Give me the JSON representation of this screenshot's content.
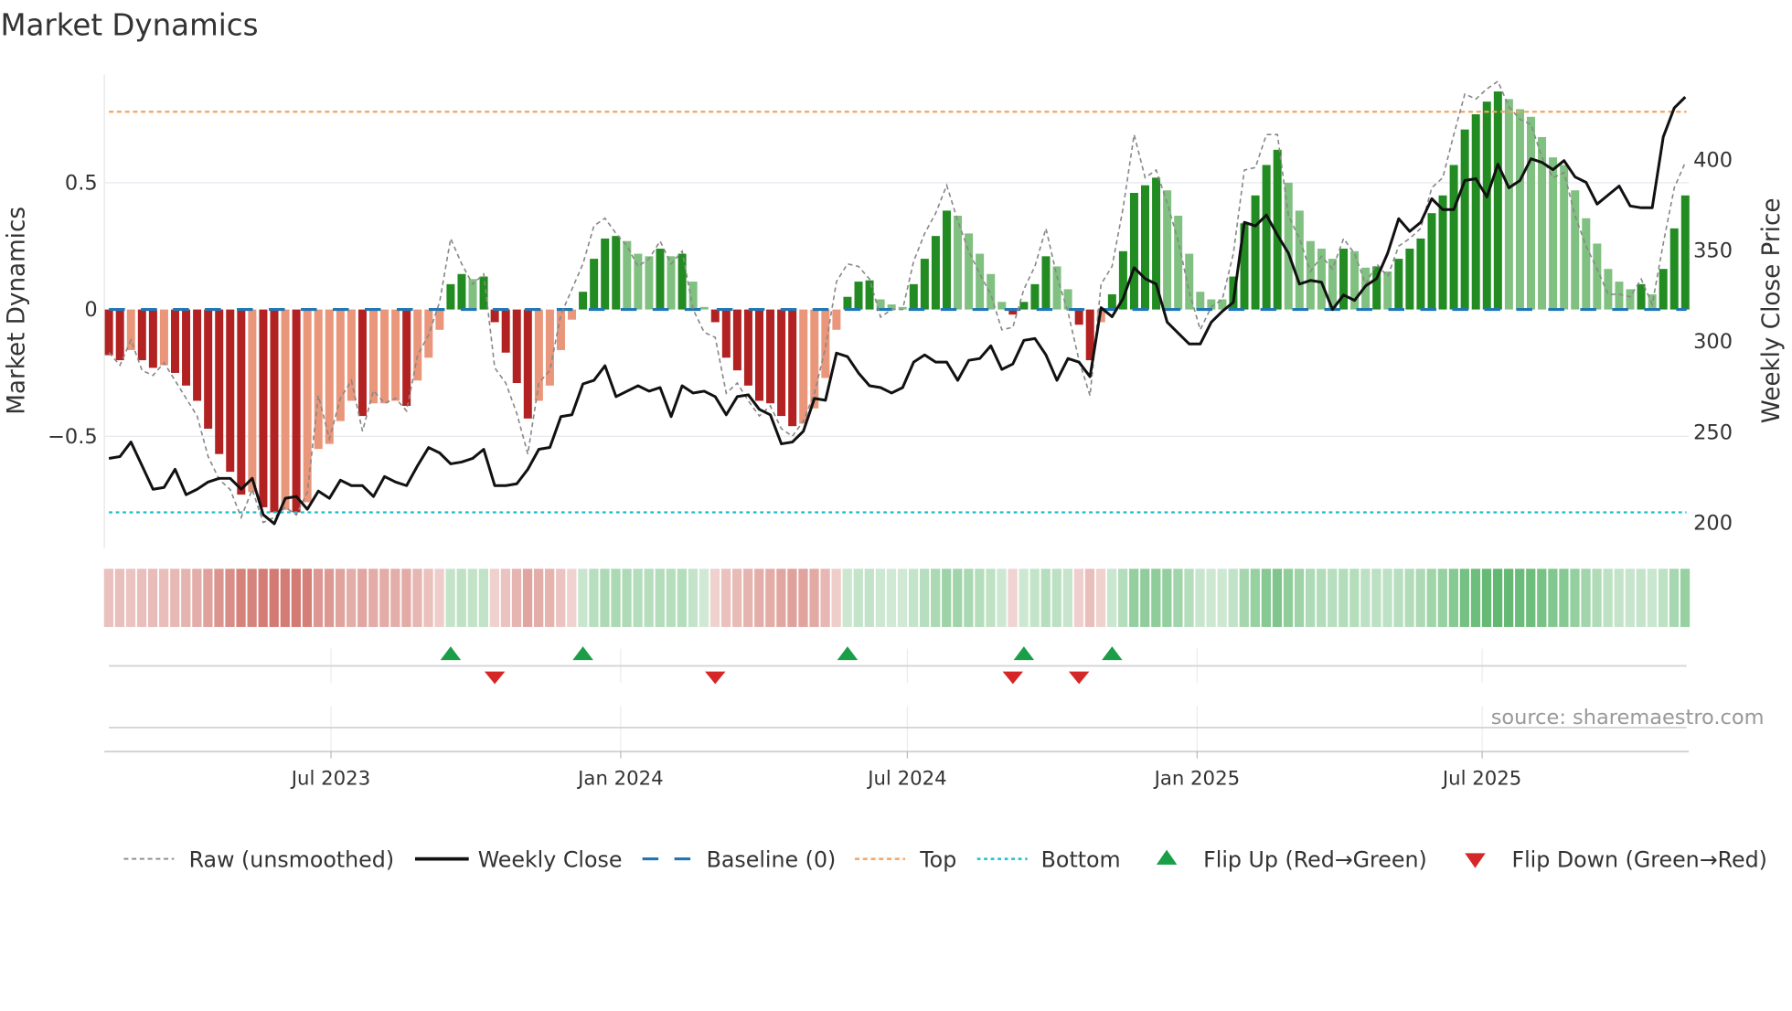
{
  "chart_data": {
    "type": "bar",
    "title": "Market Dynamics",
    "ylabel": "Market Dynamics",
    "y2label": "Weekly Close Price",
    "ylim": [
      -0.95,
      0.93
    ],
    "y2lim": [
      186,
      451
    ],
    "yticks": [
      {
        "v": 0.5,
        "label": "0.5"
      },
      {
        "v": 0,
        "label": "0"
      },
      {
        "v": -0.5,
        "label": "−0.5"
      }
    ],
    "y2ticks": [
      {
        "v": 400,
        "label": "400"
      },
      {
        "v": 350,
        "label": "350"
      },
      {
        "v": 300,
        "label": "300"
      },
      {
        "v": 250,
        "label": "250"
      },
      {
        "v": 200,
        "label": "200"
      }
    ],
    "x_start": "2023-02-10",
    "x_interval_days": 7,
    "xticks": [
      {
        "date": "2023-07-01",
        "label": "Jul 2023"
      },
      {
        "date": "2024-01-01",
        "label": "Jan 2024"
      },
      {
        "date": "2024-07-01",
        "label": "Jul 2024"
      },
      {
        "date": "2025-01-01",
        "label": "Jan 2025"
      },
      {
        "date": "2025-07-01",
        "label": "Jul 2025"
      }
    ],
    "top_level": 0.78,
    "bottom_level": -0.8,
    "baseline": 0,
    "dynamics": [
      -0.18,
      -0.2,
      -0.16,
      -0.2,
      -0.23,
      -0.22,
      -0.25,
      -0.3,
      -0.36,
      -0.47,
      -0.57,
      -0.64,
      -0.73,
      -0.72,
      -0.78,
      -0.8,
      -0.79,
      -0.8,
      -0.76,
      -0.55,
      -0.53,
      -0.44,
      -0.36,
      -0.42,
      -0.37,
      -0.37,
      -0.36,
      -0.38,
      -0.28,
      -0.19,
      -0.08,
      0.1,
      0.14,
      0.12,
      0.13,
      -0.05,
      -0.17,
      -0.29,
      -0.43,
      -0.36,
      -0.3,
      -0.16,
      -0.04,
      0.07,
      0.2,
      0.28,
      0.29,
      0.27,
      0.22,
      0.21,
      0.24,
      0.21,
      0.22,
      0.11,
      0.01,
      -0.05,
      -0.19,
      -0.24,
      -0.3,
      -0.36,
      -0.37,
      -0.42,
      -0.46,
      -0.45,
      -0.39,
      -0.27,
      -0.08,
      0.05,
      0.11,
      0.115,
      0.04,
      0.02,
      0.01,
      0.1,
      0.2,
      0.29,
      0.39,
      0.37,
      0.3,
      0.22,
      0.14,
      0.03,
      -0.02,
      0.03,
      0.1,
      0.21,
      0.17,
      0.08,
      -0.06,
      -0.2,
      -0.05,
      0.06,
      0.23,
      0.46,
      0.49,
      0.52,
      0.47,
      0.37,
      0.22,
      0.07,
      0.04,
      0.04,
      0.13,
      0.34,
      0.45,
      0.57,
      0.63,
      0.5,
      0.39,
      0.27,
      0.24,
      0.2,
      0.24,
      0.23,
      0.165,
      0.17,
      0.15,
      0.2,
      0.24,
      0.28,
      0.38,
      0.45,
      0.57,
      0.71,
      0.77,
      0.82,
      0.86,
      0.83,
      0.79,
      0.76,
      0.68,
      0.6,
      0.57,
      0.47,
      0.36,
      0.26,
      0.16,
      0.11,
      0.08,
      0.1,
      0.06,
      0.16,
      0.32,
      0.45
    ],
    "raw": [
      -0.17,
      -0.22,
      -0.12,
      -0.24,
      -0.26,
      -0.21,
      -0.28,
      -0.35,
      -0.42,
      -0.58,
      -0.67,
      -0.71,
      -0.82,
      -0.71,
      -0.84,
      -0.82,
      -0.78,
      -0.81,
      -0.72,
      -0.34,
      -0.51,
      -0.35,
      -0.28,
      -0.48,
      -0.32,
      -0.37,
      -0.35,
      -0.4,
      -0.18,
      -0.1,
      0.03,
      0.28,
      0.18,
      0.1,
      0.14,
      -0.23,
      -0.29,
      -0.41,
      -0.57,
      -0.29,
      -0.24,
      -0.02,
      0.08,
      0.18,
      0.33,
      0.36,
      0.3,
      0.25,
      0.17,
      0.2,
      0.27,
      0.18,
      0.23,
      0.0,
      -0.09,
      -0.11,
      -0.33,
      -0.29,
      -0.36,
      -0.42,
      -0.38,
      -0.47,
      -0.5,
      -0.44,
      -0.33,
      -0.15,
      0.11,
      0.18,
      0.17,
      0.12,
      -0.03,
      0.0,
      0.0,
      0.19,
      0.3,
      0.38,
      0.49,
      0.35,
      0.23,
      0.14,
      0.06,
      -0.08,
      -0.07,
      0.08,
      0.17,
      0.32,
      0.13,
      -0.01,
      -0.2,
      -0.34,
      0.1,
      0.17,
      0.4,
      0.69,
      0.52,
      0.55,
      0.42,
      0.27,
      0.07,
      -0.08,
      0.01,
      0.04,
      0.22,
      0.55,
      0.56,
      0.69,
      0.69,
      0.37,
      0.28,
      0.15,
      0.21,
      0.16,
      0.28,
      0.22,
      0.1,
      0.18,
      0.13,
      0.25,
      0.28,
      0.32,
      0.48,
      0.52,
      0.69,
      0.85,
      0.83,
      0.87,
      0.9,
      0.8,
      0.75,
      0.73,
      0.6,
      0.52,
      0.54,
      0.37,
      0.25,
      0.16,
      0.06,
      0.06,
      0.05,
      0.12,
      0.02,
      0.26,
      0.48,
      0.58
    ],
    "close": [
      235,
      236,
      244,
      231,
      218,
      219,
      229,
      215,
      218,
      222,
      224,
      224,
      218,
      224,
      204,
      199,
      213,
      214,
      207,
      217,
      213,
      223,
      220,
      220,
      214,
      225,
      222,
      220,
      231,
      241,
      238,
      232,
      233,
      235,
      240,
      220,
      220,
      221,
      229,
      240,
      241,
      258,
      259,
      276,
      278,
      286,
      269,
      272,
      275,
      272,
      274,
      258,
      275,
      271,
      272,
      269,
      259,
      269,
      270,
      262,
      259,
      243,
      244,
      250,
      268,
      267,
      293,
      291,
      282,
      275,
      274,
      271,
      274,
      288,
      292,
      288,
      288,
      278,
      289,
      290,
      297,
      284,
      287,
      300,
      301,
      292,
      278,
      290,
      288,
      280,
      318,
      313,
      323,
      340,
      334,
      331,
      310,
      304,
      298,
      298,
      310,
      316,
      321,
      365,
      363,
      369,
      358,
      348,
      331,
      333,
      332,
      317,
      325,
      322,
      330,
      334,
      348,
      367,
      360,
      365,
      378,
      372,
      372,
      388,
      389,
      379,
      397,
      384,
      388,
      400,
      398,
      394,
      399,
      390,
      387,
      375,
      380,
      385,
      374,
      373,
      373,
      412,
      428,
      434
    ],
    "flip_up": [
      31,
      43,
      67,
      83,
      91
    ],
    "flip_down": [
      35,
      55,
      82,
      88
    ],
    "legend_placement": "bottom",
    "legend": {
      "raw": "Raw (unsmoothed)",
      "close": "Weekly Close",
      "baseline": "Baseline (0)",
      "top": "Top",
      "bottom": "Bottom",
      "flip_up": "Flip Up (Red→Green)",
      "flip_down": "Flip Down (Green→Red)"
    },
    "source": "source: sharemaestro.com",
    "colors": {
      "bar_neg_strong": "#b22222",
      "bar_neg_weak": "#e9967a",
      "bar_pos_strong": "#228b22",
      "bar_pos_weak": "#80c080",
      "close": "#111111",
      "raw": "#888888",
      "baseline": "#1f77b4",
      "top": "#f4a460",
      "bottom": "#17becf",
      "flip_up": "#1a9e48",
      "flip_down": "#d62728"
    }
  }
}
